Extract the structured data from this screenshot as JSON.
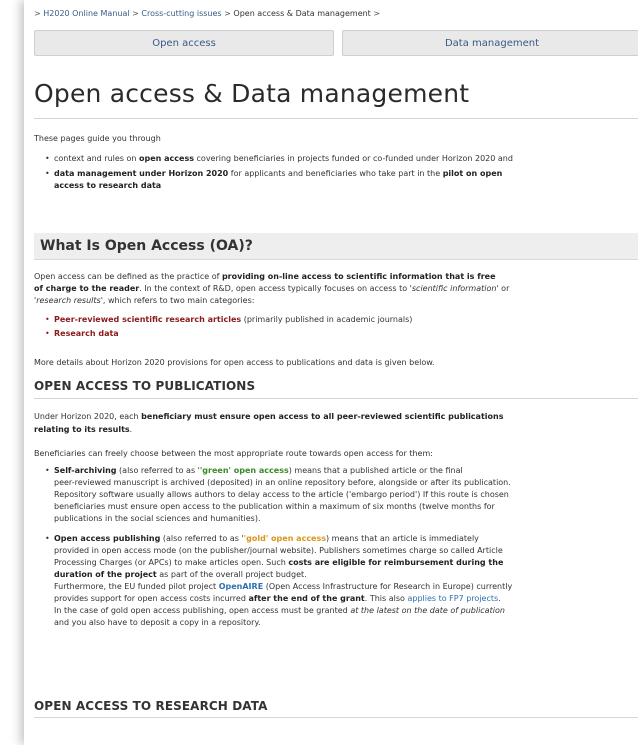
{
  "breadcrumb": {
    "prefix": ">",
    "items": [
      "H2020 Online Manual",
      "Cross-cutting issues",
      "Open access & Data management"
    ],
    "sep": ">",
    "trail": ">"
  },
  "tabs": [
    "Open access",
    "Data management"
  ],
  "page_title": "Open access & Data management",
  "intro": "These pages guide you through",
  "intro_items": [
    {
      "a": "context and rules on ",
      "b": "open access",
      "c": " covering beneficiaries in projects funded or co-funded under Horizon 2020 and"
    },
    {
      "a": "data management under Horizon 2020",
      "b": " for applicants and beneficiaries who take part in the ",
      "c": "pilot on open",
      "d": "access to research data"
    }
  ],
  "section_oa": {
    "title": "What Is Open Access (OA)?",
    "p1": {
      "a": "Open access can be defined as the practice of ",
      "b": "providing on-line access to scientific information that is free",
      "c": "of charge to the reader",
      "d": ". In the context of R&D, open access typically focuses on access to '",
      "e": "scientific information",
      "f": "' or",
      "g": "'",
      "h": "research results",
      "i": "', which refers to two main categories:"
    },
    "categories": [
      {
        "bold": "Peer-reviewed scientific research articles",
        "rest": " (primarily published in academic journals)"
      },
      {
        "bold": "Research data",
        "rest": ""
      }
    ],
    "p2": "More details about Horizon 2020 provisions for open access to publications and data is given below."
  },
  "section_pub": {
    "title": "OPEN ACCESS TO PUBLICATIONS",
    "p1": {
      "a": "Under Horizon 2020, each ",
      "b": "beneficiary must ensure open access to all peer-reviewed scientific publications",
      "c": "relating to its results",
      "d": "."
    },
    "p2": "Beneficiaries can freely choose between the most appropriate route towards open access for them:",
    "self": {
      "b1": "Self-archiving",
      "t1": " (also referred to as '",
      "g": "'green' open access",
      "t2": ") means that a published article or the final",
      "l2": "peer-reviewed manuscript is archived (deposited) in an online repository before, alongside or after its publication.",
      "l3": "Repository software usually allows authors to delay access to the article ('embargo period') If this route is chosen",
      "l4": "beneficiaries must ensure open access to the publication within a maximum of six months (twelve months for",
      "l5": "publications in the social sciences and humanities)."
    },
    "gold": {
      "b1": "Open access publishing",
      "t1": " (also referred to as '",
      "g": "'gold' open access",
      "t2": ") means that an article is immediately",
      "l2": "provided in open access mode (on the publisher/journal website). Publishers sometimes charge so called Article",
      "l3a": "Processing Charges (or APCs) to make articles open. Such ",
      "l3b": "costs are eligible for reimbursement during the",
      "l4a": "duration of the project",
      "l4b": " as part of the overall project budget.",
      "l5a": "Furthermore, the EU funded pilot project ",
      "l5b": "OpenAIRE",
      "l5c": " (Open Access Infrastructure for Research in Europe) currently",
      "l6a": "provides support for open access costs incurred ",
      "l6b": "after the end of the grant",
      "l6c": ". This also ",
      "l6d": "applies to FP7 projects",
      "l6e": ".",
      "l7a": "In the case of gold open access publishing, open access must be granted ",
      "l7b": "at the latest on the date of publication",
      "l8": "and you also have to deposit a copy in a repository."
    }
  },
  "section_data": {
    "title": "OPEN ACCESS TO RESEARCH DATA"
  }
}
